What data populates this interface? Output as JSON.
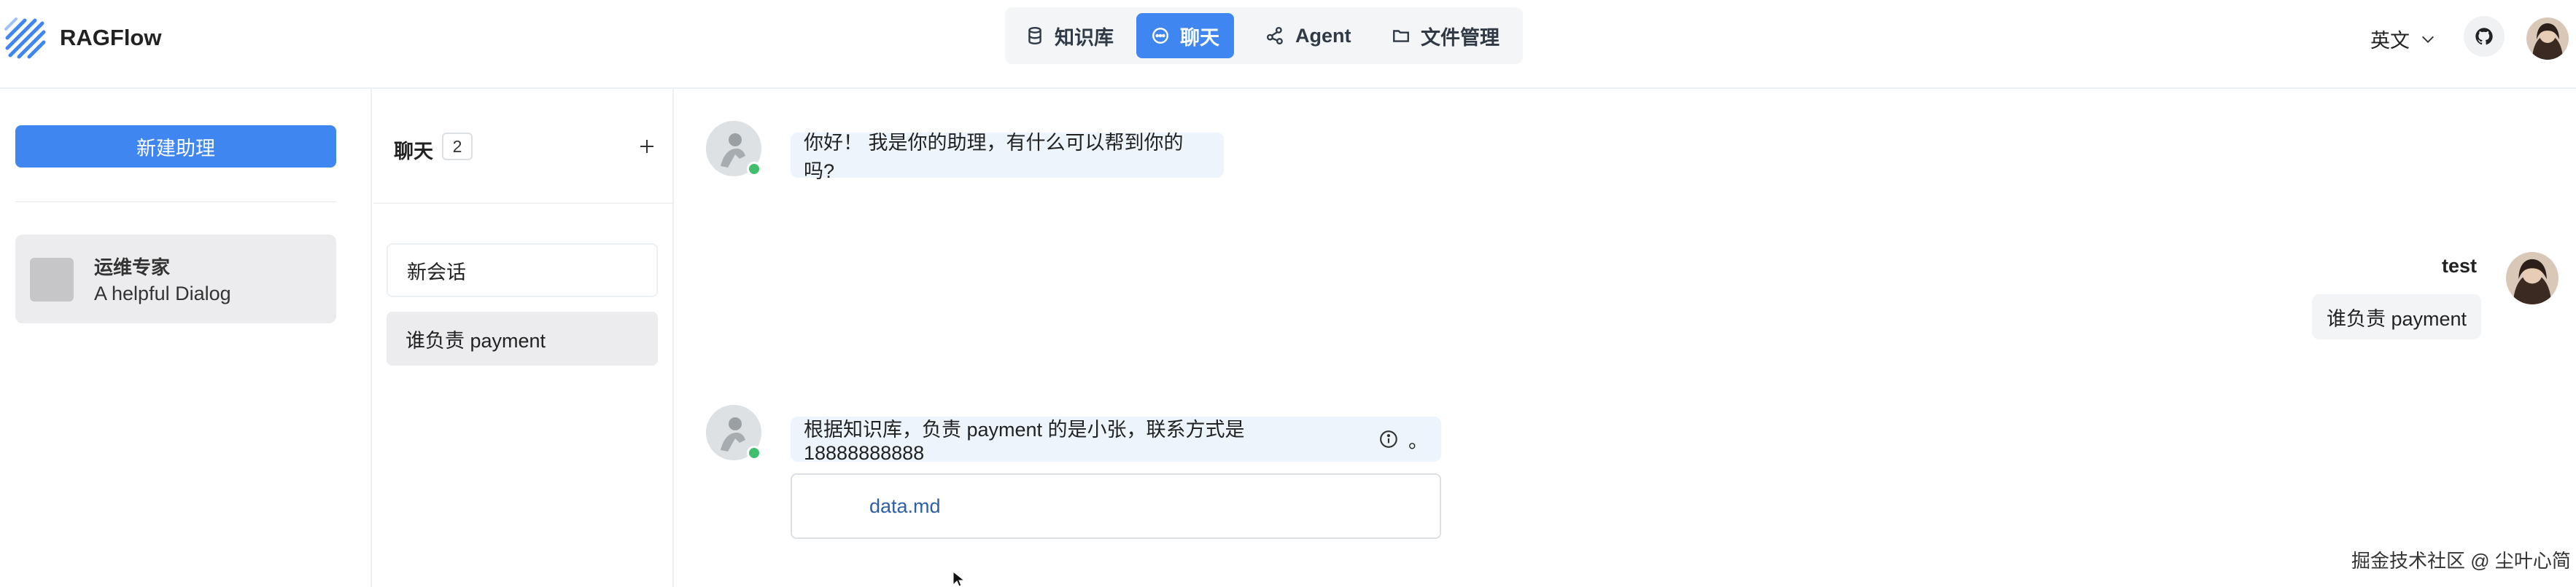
{
  "app": {
    "brand": "RAGFlow"
  },
  "nav": {
    "items": [
      {
        "label": "知识库",
        "icon": "database-icon",
        "active": false
      },
      {
        "label": "聊天",
        "icon": "chat-bubble-icon",
        "active": true
      },
      {
        "label": "Agent",
        "icon": "graph-nodes-icon",
        "active": false
      },
      {
        "label": "文件管理",
        "icon": "folder-icon",
        "active": false
      }
    ]
  },
  "header": {
    "language": "英文",
    "github_icon": "github-icon"
  },
  "sidebar": {
    "new_assistant_label": "新建助理",
    "assistants": [
      {
        "name": "运维专家",
        "description": "A helpful Dialog"
      }
    ]
  },
  "conversations": {
    "title": "聊天",
    "count": "2",
    "items": [
      {
        "label": "新会话"
      },
      {
        "label": "谁负责 payment"
      }
    ]
  },
  "chat": {
    "messages": [
      {
        "role": "assistant",
        "text": "你好！ 我是你的助理，有什么可以帮到你的吗?"
      },
      {
        "role": "user",
        "name": "test",
        "text": "谁负责 payment"
      },
      {
        "role": "assistant",
        "text": "根据知识库，负责 payment 的是小张，联系方式是 18888888888",
        "suffix": "。",
        "sources": [
          "data.md"
        ]
      }
    ]
  },
  "watermark": "掘金技术社区 @ 尘叶心简",
  "colors": {
    "accent": "#3f86f1",
    "online": "#3fbf6b",
    "bot_bubble": "#edf4fc"
  }
}
